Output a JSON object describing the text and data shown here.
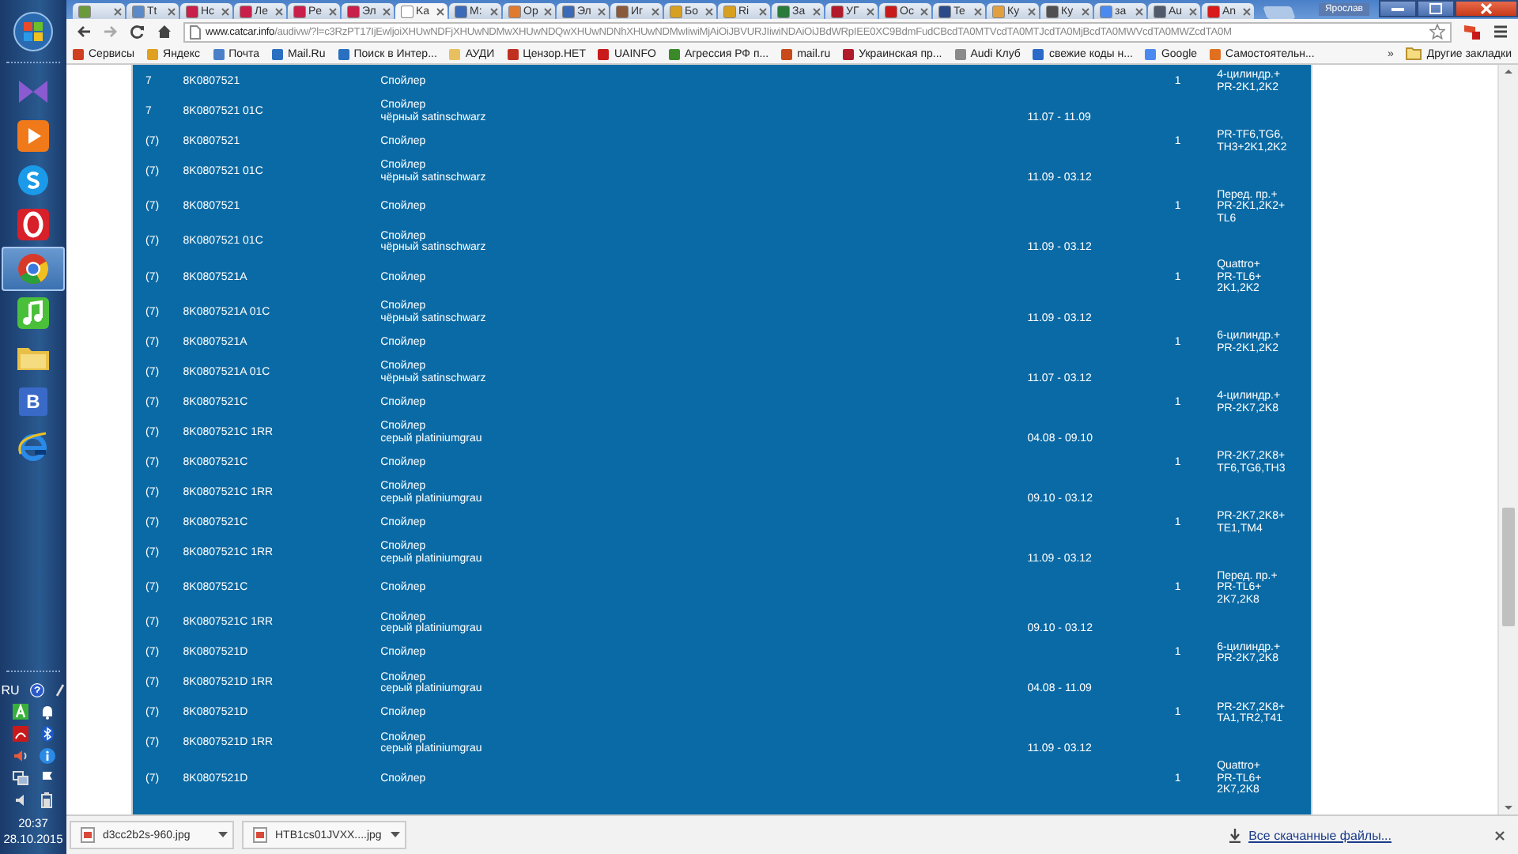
{
  "taskbar": {
    "apps": [
      {
        "kind": "studio",
        "selected": false
      },
      {
        "kind": "player",
        "selected": false
      },
      {
        "kind": "skype",
        "selected": false
      },
      {
        "kind": "opera",
        "selected": false
      },
      {
        "kind": "chrome",
        "selected": true
      },
      {
        "kind": "music",
        "selected": false
      },
      {
        "kind": "folder",
        "selected": false
      },
      {
        "kind": "letter",
        "label": "В",
        "selected": false
      },
      {
        "kind": "ie",
        "selected": false
      }
    ],
    "tray": {
      "language": "RU",
      "time": "20:37",
      "date": "28.10.2015"
    }
  },
  "browser": {
    "profile": "Ярослав",
    "tabs": [
      {
        "color": "#6a9a3a",
        "selected": false
      },
      {
        "title": "Tt",
        "color": "#5a8ac8",
        "selected": false
      },
      {
        "title": "Hc",
        "color": "#c8204a",
        "selected": false
      },
      {
        "title": "Ле",
        "color": "#c8204a",
        "selected": false
      },
      {
        "title": "Pe",
        "color": "#c8204a",
        "selected": false
      },
      {
        "title": "Эл",
        "color": "#c8204a",
        "selected": false
      },
      {
        "title": "Ka",
        "color": "#ffffff",
        "selected": true
      },
      {
        "title": "M:",
        "color": "#3a6ab8",
        "selected": false
      },
      {
        "title": "Op",
        "color": "#e07a30",
        "selected": false
      },
      {
        "title": "Эл",
        "color": "#3a6ab8",
        "selected": false
      },
      {
        "title": "Иг",
        "color": "#8a5a3a",
        "selected": false
      },
      {
        "title": "Бо",
        "color": "#d8a020",
        "selected": false
      },
      {
        "title": "Ri",
        "color": "#d8a020",
        "selected": false
      },
      {
        "title": "За",
        "color": "#2a7a3a",
        "selected": false
      },
      {
        "title": "УГ",
        "color": "#b01a2a",
        "selected": false
      },
      {
        "title": "Ос",
        "color": "#c81a1a",
        "selected": false
      },
      {
        "title": "Te",
        "color": "#2a4a8a",
        "selected": false
      },
      {
        "title": "Ку",
        "color": "#e0a040",
        "selected": false
      },
      {
        "title": "Ку",
        "color": "#505050",
        "selected": false
      },
      {
        "title": "за",
        "color": "#4a8af0",
        "selected": false
      },
      {
        "title": "Au",
        "color": "#505a6a",
        "selected": false
      },
      {
        "title": "An",
        "color": "#d81a1a",
        "selected": false
      }
    ],
    "address": {
      "host": "www.catcar.info",
      "path": "/audivw/?l=c3RzPT17IjEwljoiXHUwNDFjXHUwNDMwXHUwNDQwXHUwNDNhXHUwNDMwIiwiMjAiOiJBVURJIiwiNDAiOiJBdWRpIEE0XC9BdmFudCBcdTA0MTVcdTA0MTJcdTA0MjBcdTA0MWVcdTA0MWZcdTA0M"
    },
    "bookmarks": [
      {
        "label": "Сервисы",
        "color": "#d04020"
      },
      {
        "label": "Яндекс",
        "color": "#e0a020"
      },
      {
        "label": "Почта",
        "color": "#4a80c8"
      },
      {
        "label": "Mail.Ru",
        "color": "#2a70c0"
      },
      {
        "label": "Поиск в Интер...",
        "color": "#2a70c0"
      },
      {
        "label": "АУДИ",
        "color": "#e8c060"
      },
      {
        "label": "Цензор.НЕТ",
        "color": "#c03020"
      },
      {
        "label": "UAINFO",
        "color": "#c81a1a"
      },
      {
        "label": "Агрессия РФ п...",
        "color": "#3a8a2a"
      },
      {
        "label": "mail.ru",
        "color": "#c84a1a"
      },
      {
        "label": "Украинская пр...",
        "color": "#b01a2a"
      },
      {
        "label": "Audi Клуб",
        "color": "#8a8a8a"
      },
      {
        "label": "свежие коды н...",
        "color": "#2a6ac8"
      },
      {
        "label": "Google",
        "color": "#4a8af0"
      },
      {
        "label": "Самостоятельн...",
        "color": "#e07020"
      }
    ],
    "bookmarks_more": "»",
    "other_bookmarks": "Другие закладки"
  },
  "parts": [
    {
      "col1": "7",
      "number": "8K0807521",
      "description": "Спойлер",
      "qty": "1",
      "notes": "4-цилиндр.+\nPR-2K1,2K2"
    },
    {
      "col1": "7",
      "number": "8K0807521 01C",
      "description": "Спойлер\nчёрный satinschwarz",
      "date": "11.07 - 11.09"
    },
    {
      "col1": "(7)",
      "number": "8K0807521",
      "description": "Спойлер",
      "qty": "1",
      "notes": "PR-TF6,TG6,\nTH3+2K1,2K2"
    },
    {
      "col1": "(7)",
      "number": "8K0807521 01C",
      "description": "Спойлер\nчёрный satinschwarz",
      "date": "11.09 - 03.12"
    },
    {
      "col1": "(7)",
      "number": "8K0807521",
      "description": "Спойлер",
      "qty": "1",
      "notes": "Перед. пр.+\nPR-2K1,2K2+\nTL6"
    },
    {
      "col1": "(7)",
      "number": "8K0807521 01C",
      "description": "Спойлер\nчёрный satinschwarz",
      "date": "11.09 - 03.12"
    },
    {
      "col1": "(7)",
      "number": "8K0807521A",
      "description": "Спойлер",
      "qty": "1",
      "notes": "Quattro+\nPR-TL6+\n2K1,2K2"
    },
    {
      "col1": "(7)",
      "number": "8K0807521A 01C",
      "description": "Спойлер\nчёрный satinschwarz",
      "date": "11.09 - 03.12"
    },
    {
      "col1": "(7)",
      "number": "8K0807521A",
      "description": "Спойлер",
      "qty": "1",
      "notes": "6-цилиндр.+\nPR-2K1,2K2"
    },
    {
      "col1": "(7)",
      "number": "8K0807521A 01C",
      "description": "Спойлер\nчёрный satinschwarz",
      "date": "11.07 - 03.12"
    },
    {
      "col1": "(7)",
      "number": "8K0807521C",
      "description": "Спойлер",
      "qty": "1",
      "notes": "4-цилиндр.+\nPR-2K7,2K8"
    },
    {
      "col1": "(7)",
      "number": "8K0807521C 1RR",
      "description": "Спойлер\nсерый platiniumgrau",
      "date": "04.08 - 09.10"
    },
    {
      "col1": "(7)",
      "number": "8K0807521C",
      "description": "Спойлер",
      "qty": "1",
      "notes": "PR-2K7,2K8+\nTF6,TG6,TH3"
    },
    {
      "col1": "(7)",
      "number": "8K0807521C 1RR",
      "description": "Спойлер\nсерый platiniumgrau",
      "date": "09.10 - 03.12"
    },
    {
      "col1": "(7)",
      "number": "8K0807521C",
      "description": "Спойлер",
      "qty": "1",
      "notes": "PR-2K7,2K8+\nTE1,TM4"
    },
    {
      "col1": "(7)",
      "number": "8K0807521C 1RR",
      "description": "Спойлер\nсерый platiniumgrau",
      "date": "11.09 - 03.12"
    },
    {
      "col1": "(7)",
      "number": "8K0807521C",
      "description": "Спойлер",
      "qty": "1",
      "notes": "Перед. пр.+\nPR-TL6+\n2K7,2K8"
    },
    {
      "col1": "(7)",
      "number": "8K0807521C 1RR",
      "description": "Спойлер\nсерый platiniumgrau",
      "date": "09.10 - 03.12"
    },
    {
      "col1": "(7)",
      "number": "8K0807521D",
      "description": "Спойлер",
      "qty": "1",
      "notes": "6-цилиндр.+\nPR-2K7,2K8"
    },
    {
      "col1": "(7)",
      "number": "8K0807521D 1RR",
      "description": "Спойлер\nсерый platiniumgrau",
      "date": "04.08 - 11.09"
    },
    {
      "col1": "(7)",
      "number": "8K0807521D",
      "description": "Спойлер",
      "qty": "1",
      "notes": "PR-2K7,2K8+\nTA1,TR2,T41"
    },
    {
      "col1": "(7)",
      "number": "8K0807521D 1RR",
      "description": "Спойлер\nсерый platiniumgrau",
      "date": "11.09 - 03.12"
    },
    {
      "col1": "(7)",
      "number": "8K0807521D",
      "description": "Спойлер",
      "qty": "1",
      "notes": "Quattro+\nPR-TL6+\n2K7,2K8"
    }
  ],
  "downloads": {
    "files": [
      "d3cc2b2s-960.jpg",
      "HTB1cs01JVXX....jpg"
    ],
    "all_link": "Все скачанные файлы..."
  }
}
